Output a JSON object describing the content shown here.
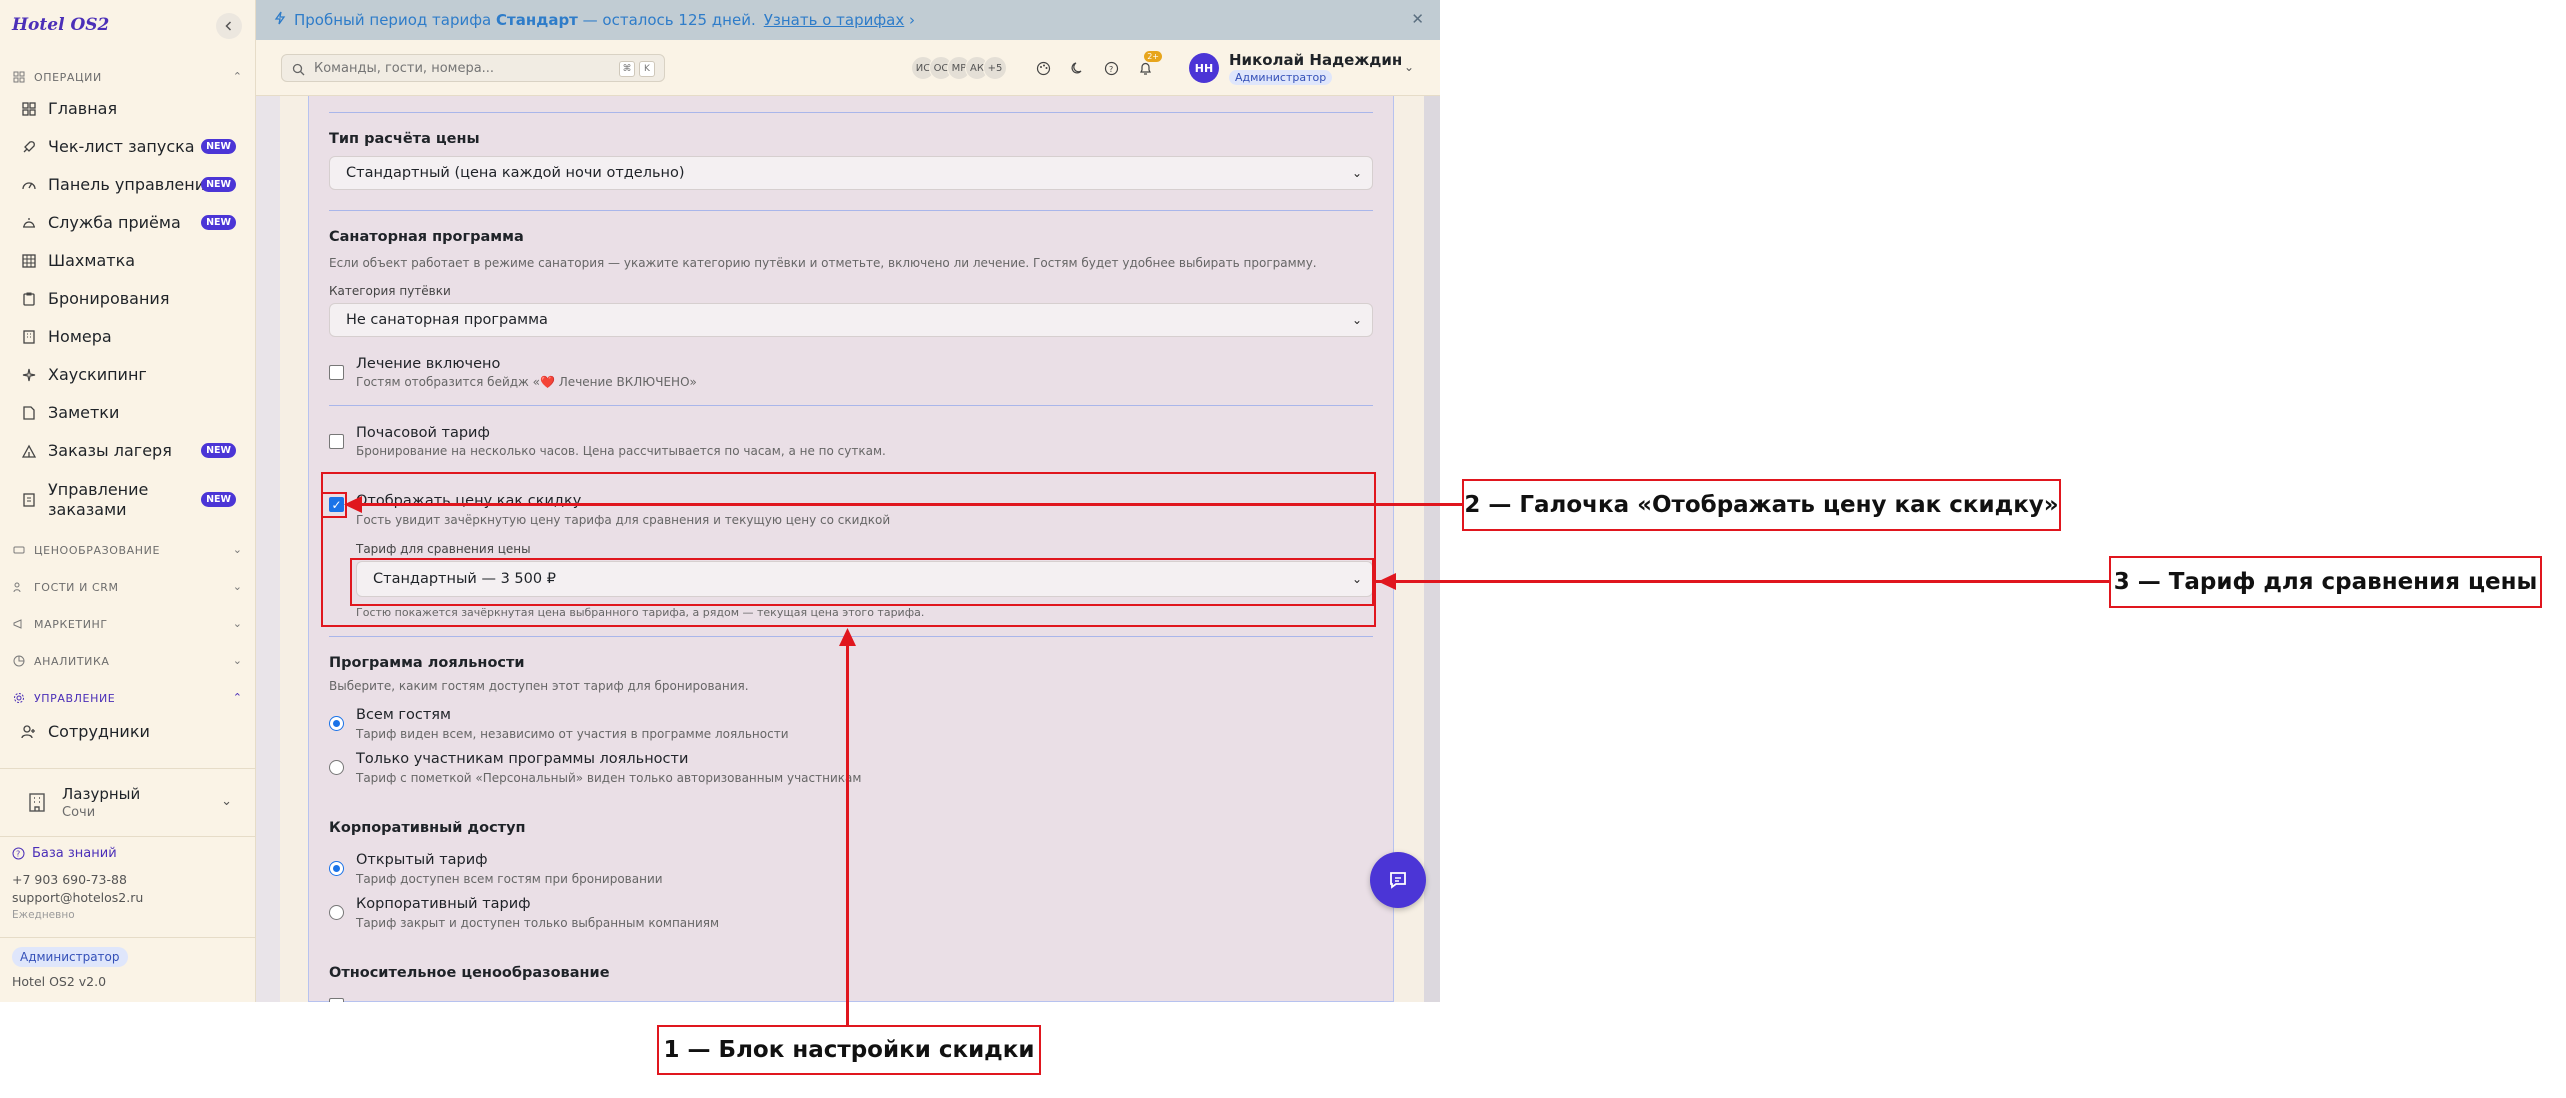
{
  "sidebar": {
    "logo": "Hotel OS2",
    "sections": [
      {
        "label": "ОПЕРАЦИИ"
      },
      {
        "label": "ЦЕНООБРАЗОВАНИЕ"
      },
      {
        "label": "ГОСТИ И CRM"
      },
      {
        "label": "МАРКЕТИНГ"
      },
      {
        "label": "АНАЛИТИКА"
      },
      {
        "label": "УПРАВЛЕНИЕ"
      }
    ],
    "items": [
      {
        "label": "Главная"
      },
      {
        "label": "Чек-лист запуска",
        "badge": "NEW"
      },
      {
        "label": "Панель управления",
        "badge": "NEW"
      },
      {
        "label": "Служба приёма",
        "badge": "NEW"
      },
      {
        "label": "Шахматка"
      },
      {
        "label": "Бронирования"
      },
      {
        "label": "Номера"
      },
      {
        "label": "Хаускипинг"
      },
      {
        "label": "Заметки"
      },
      {
        "label": "Заказы лагеря",
        "badge": "NEW"
      },
      {
        "label_line1": "Управление",
        "label_line2": "заказами",
        "badge": "NEW"
      },
      {
        "label": "Сотрудники"
      }
    ],
    "hotel": {
      "name": "Лазурный",
      "city": "Сочи"
    },
    "knowledge_base": "База знаний",
    "phone": "+7 903 690-73-88",
    "email": "support@hotelos2.ru",
    "hours": "Ежедневно",
    "role": "Администратор",
    "version": "Hotel OS2 v2.0"
  },
  "banner": {
    "text_before": "Пробный период тарифа",
    "plan": "Стандарт",
    "text_after": "— осталось 125 дней.",
    "link": "Узнать о тарифах",
    "link_arrow": "›",
    "close": "✕"
  },
  "header": {
    "search_placeholder": "Команды, гости, номера...",
    "kbd1": "⌘",
    "kbd2": "K",
    "avatars": [
      "ИС",
      "ОС",
      "МР",
      "АК",
      "+5"
    ],
    "notif_count": "2+",
    "user_initials": "НН",
    "user_name": "Николай Надеждин",
    "user_role": "Администратор"
  },
  "form": {
    "pricing_type_title": "Тип расчёта цены",
    "pricing_type_value": "Стандартный (цена каждой ночи отдельно)",
    "sanatorium_title": "Санаторная программа",
    "sanatorium_desc": "Если объект работает в режиме санатория — укажите категорию путёвки и отметьте, включено ли лечение. Гостям будет удобнее выбирать программу.",
    "voucher_label": "Категория путёвки",
    "voucher_value": "Не санаторная программа",
    "treatment_title": "Лечение включено",
    "treatment_desc": "Гостям отобразится бейдж «❤️ Лечение ВКЛЮЧЕНО»",
    "hourly_title": "Почасовой тариф",
    "hourly_desc": "Бронирование на несколько часов. Цена рассчитывается по часам, а не по суткам.",
    "discount_title": "Отображать цену как скидку",
    "discount_desc": "Гость увидит зачёркнутую цену тарифа для сравнения и текущую цену со скидкой",
    "compare_label": "Тариф для сравнения цены",
    "compare_value": "Стандартный — 3 500 ₽",
    "compare_hint": "Гостю покажется зачёркнутая цена выбранного тарифа, а рядом — текущая цена этого тарифа.",
    "loyalty_title": "Программа лояльности",
    "loyalty_desc": "Выберите, каким гостям доступен этот тариф для бронирования.",
    "loyalty_all_title": "Всем гостям",
    "loyalty_all_desc": "Тариф виден всем, независимо от участия в программе лояльности",
    "loyalty_members_title": "Только участникам программы лояльности",
    "loyalty_members_desc": "Тариф с пометкой «Персональный» виден только авторизованным участникам",
    "corporate_title": "Корпоративный доступ",
    "corp_open_title": "Открытый тариф",
    "corp_open_desc": "Тариф доступен всем гостям при бронировании",
    "corp_closed_title": "Корпоративный тариф",
    "corp_closed_desc": "Тариф закрыт и доступен только выбранным компаниям",
    "relative_title": "Относительное ценообразование"
  },
  "annotations": {
    "a1": "1 — Блок настройки скидки",
    "a2": "2 — Галочка «Отображать цену как скидку»",
    "a3": "3 — Тариф для сравнения цены"
  },
  "colors": {
    "accent": "#4b35d6",
    "annotation": "#e0161e",
    "banner_text": "#2e7cc9"
  }
}
